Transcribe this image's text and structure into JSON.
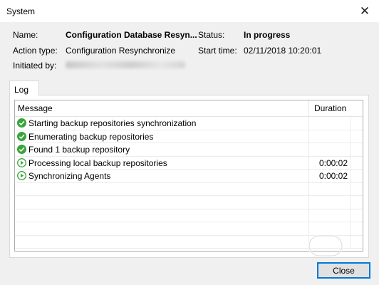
{
  "window": {
    "title": "System",
    "close_glyph": "✕"
  },
  "info": {
    "name_label": "Name:",
    "name_value": "Configuration Database Resyn...",
    "action_label": "Action type:",
    "action_value": "Configuration Resynchronize",
    "initiated_label": "Initiated by:",
    "status_label": "Status:",
    "status_value": "In progress",
    "start_label": "Start time:",
    "start_value": "02/11/2018 10:20:01"
  },
  "tabs": [
    {
      "label": "Log"
    }
  ],
  "log": {
    "columns": {
      "message": "Message",
      "duration": "Duration"
    },
    "rows": [
      {
        "status": "success",
        "message": "Starting backup repositories synchronization",
        "duration": ""
      },
      {
        "status": "success",
        "message": "Enumerating backup repositories",
        "duration": ""
      },
      {
        "status": "success",
        "message": "Found 1 backup repository",
        "duration": ""
      },
      {
        "status": "running",
        "message": "Processing local backup repositories",
        "duration": "0:00:02"
      },
      {
        "status": "running",
        "message": "Synchronizing Agents",
        "duration": "0:00:02"
      }
    ]
  },
  "buttons": {
    "close_label": "Close"
  },
  "colors": {
    "success": "#3aa53a",
    "running": "#3aa53a",
    "focus": "#0078d7"
  },
  "icons": {
    "success": "check-circle-icon",
    "running": "play-circle-icon"
  }
}
